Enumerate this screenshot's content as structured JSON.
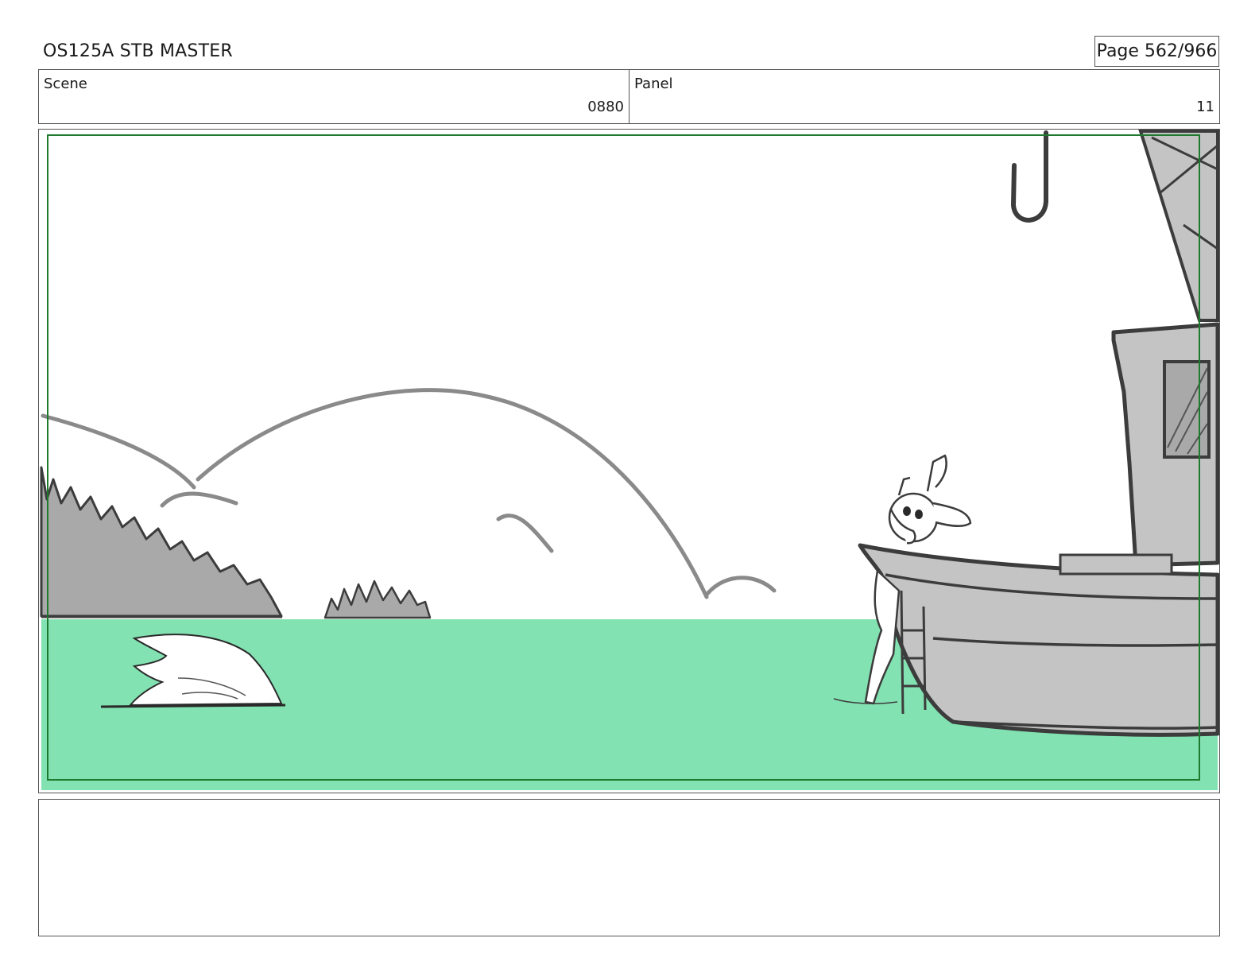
{
  "header": {
    "title": "OS125A STB MASTER",
    "page_label": "Page 562/966"
  },
  "info": {
    "scene_label": "Scene",
    "scene_value": "0880",
    "panel_label": "Panel",
    "panel_value": "11"
  },
  "colors": {
    "water": "#83e2b2",
    "safe_frame": "#1e7a2e",
    "hill_fill": "#a9a9a9",
    "boat_fill": "#c4c4c4",
    "sketch_line": "#3c3c3c"
  },
  "notes": {
    "text": ""
  }
}
